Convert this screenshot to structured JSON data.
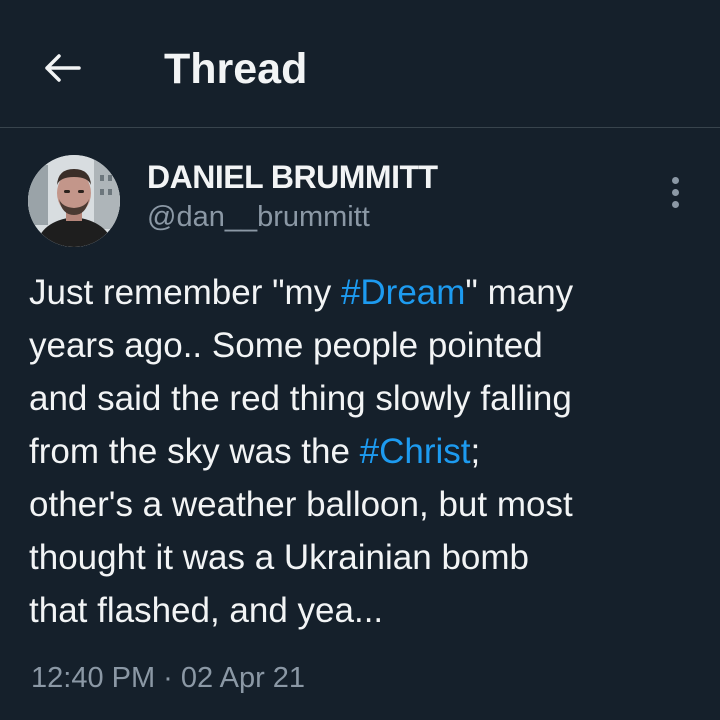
{
  "header": {
    "title": "Thread",
    "back_icon": "arrow-left-icon"
  },
  "tweet": {
    "author_name": "DANIEL BRUMMITT",
    "author_handle": "@dan__brummitt",
    "more_icon": "more-vertical-icon",
    "text_part1": "Just remember \"my ",
    "hashtag1": "#Dream",
    "text_part2": "\" many\nyears ago.. Some people pointed\nand said the red thing slowly falling\nfrom the sky was the ",
    "hashtag2": "#Christ",
    "text_part3": ";\nother's a weather balloon, but most\nthought it was a Ukrainian bomb\nthat flashed, and yea...",
    "timestamp": "12:40 PM · 02 Apr 21"
  },
  "colors": {
    "background": "#15202b",
    "link": "#1d9bf0",
    "secondary_text": "#8b98a5"
  }
}
